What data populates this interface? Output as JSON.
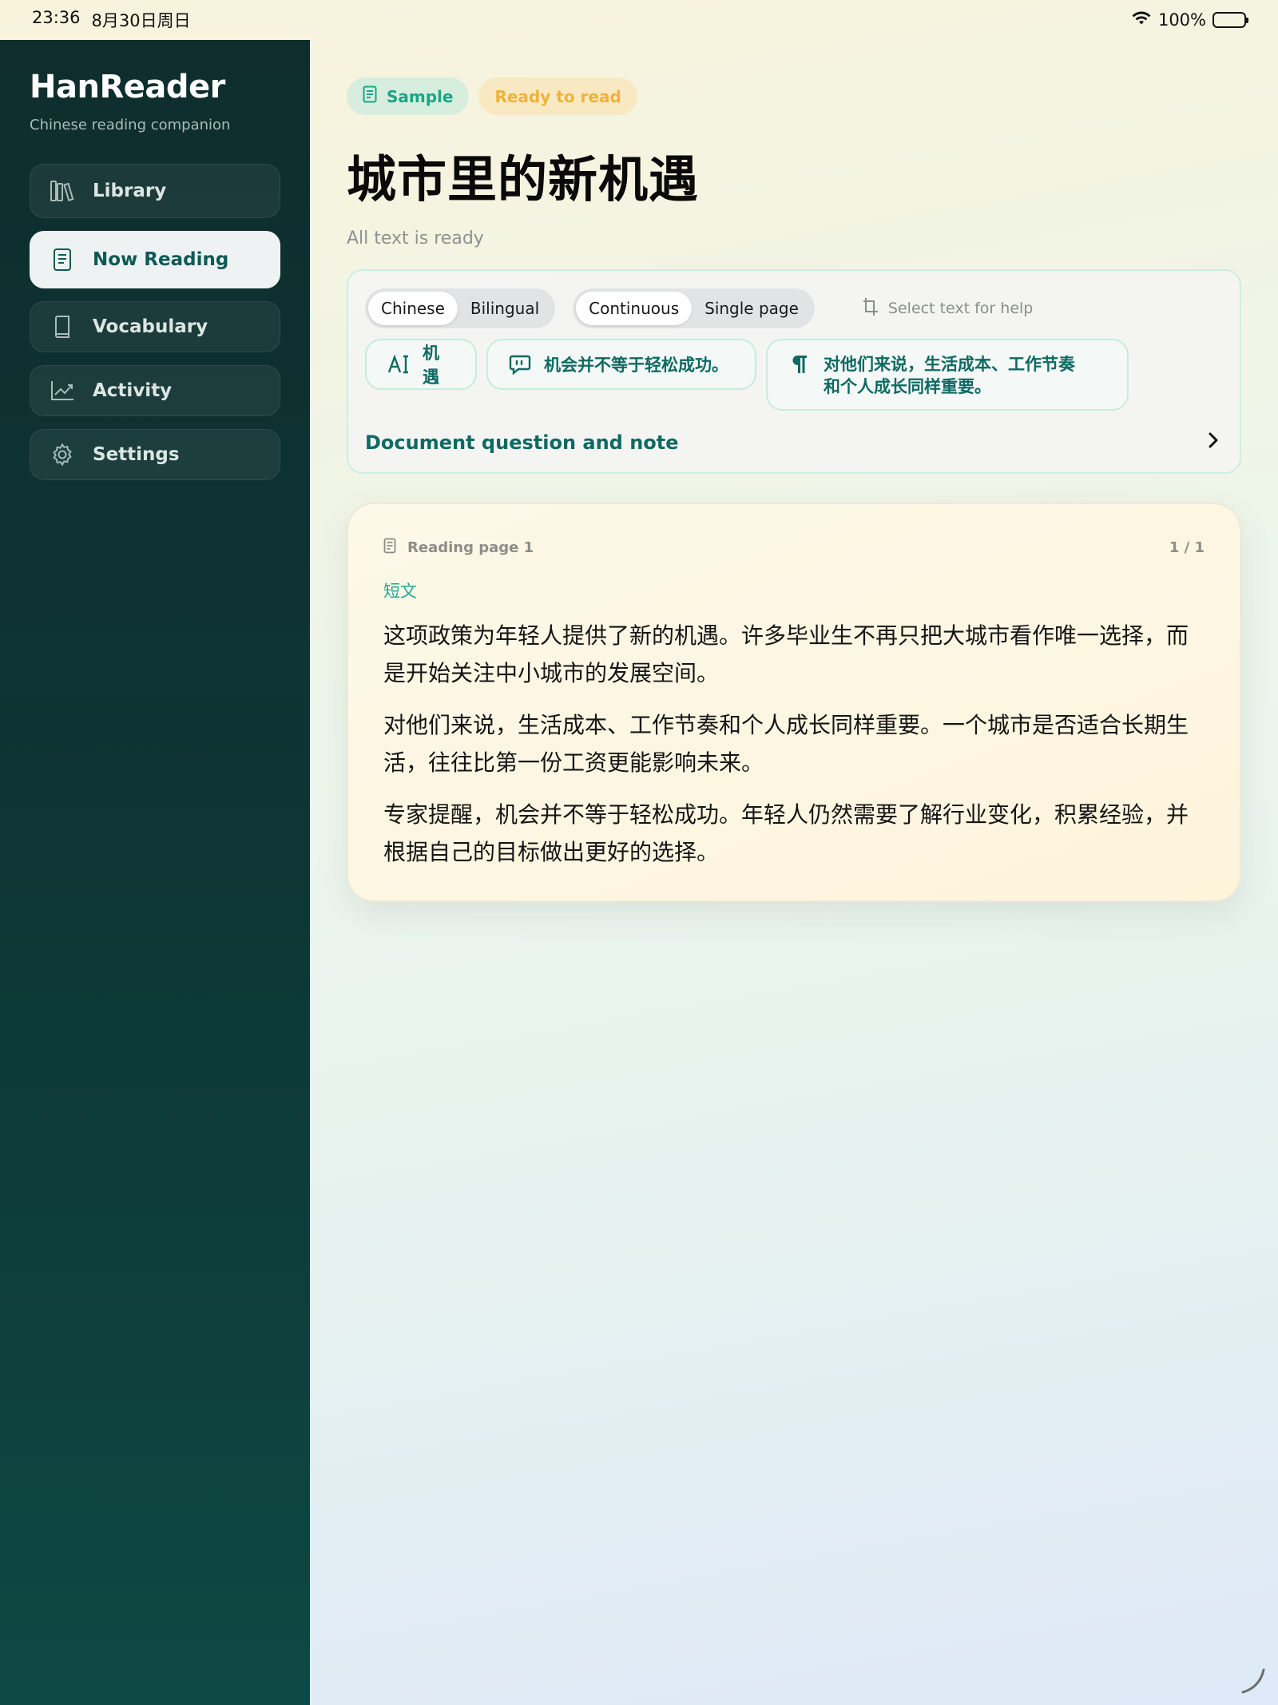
{
  "status_bar": {
    "time": "23:36",
    "date": "8月30日周日",
    "battery": "100%"
  },
  "sidebar": {
    "brand": "HanReader",
    "tagline": "Chinese reading companion",
    "items": [
      {
        "label": "Library",
        "icon": "books-icon"
      },
      {
        "label": "Now Reading",
        "icon": "reader-icon",
        "active": true
      },
      {
        "label": "Vocabulary",
        "icon": "book-icon"
      },
      {
        "label": "Activity",
        "icon": "chart-icon"
      },
      {
        "label": "Settings",
        "icon": "gear-icon"
      }
    ]
  },
  "main": {
    "chips": {
      "sample": "Sample",
      "ready": "Ready to read"
    },
    "title": "城市里的新机遇",
    "subtitle": "All text is ready",
    "tools": {
      "mode": {
        "chinese": "Chinese",
        "bilingual": "Bilingual",
        "selected": "Chinese"
      },
      "layout": {
        "continuous": "Continuous",
        "single": "Single page",
        "selected": "Continuous"
      },
      "hint": "Select text for help",
      "pills": {
        "word": "机遇",
        "sentence": "机会并不等于轻松成功。",
        "paragraph_line1": "对他们来说，生活成本、工作节奏",
        "paragraph_line2": "和个人成长同样重要。"
      },
      "doc_question": "Document question and note"
    },
    "reader": {
      "page_label": "Reading page 1",
      "page_count": "1 / 1",
      "section": "短文",
      "paragraphs": [
        "这项政策为年轻人提供了新的机遇。许多毕业生不再只把大城市看作唯一选择，而是开始关注中小城市的发展空间。",
        "对他们来说，生活成本、工作节奏和个人成长同样重要。一个城市是否适合长期生活，往往比第一份工资更能影响未来。",
        "专家提醒，机会并不等于轻松成功。年轻人仍然需要了解行业变化，积累经验，并根据自己的目标做出更好的选择。"
      ]
    }
  },
  "colors": {
    "sidebar_dark": "#0f2d2d",
    "accent_teal": "#0e6a62",
    "sample_green": "#1aa686",
    "ready_amber": "#f0b238"
  }
}
